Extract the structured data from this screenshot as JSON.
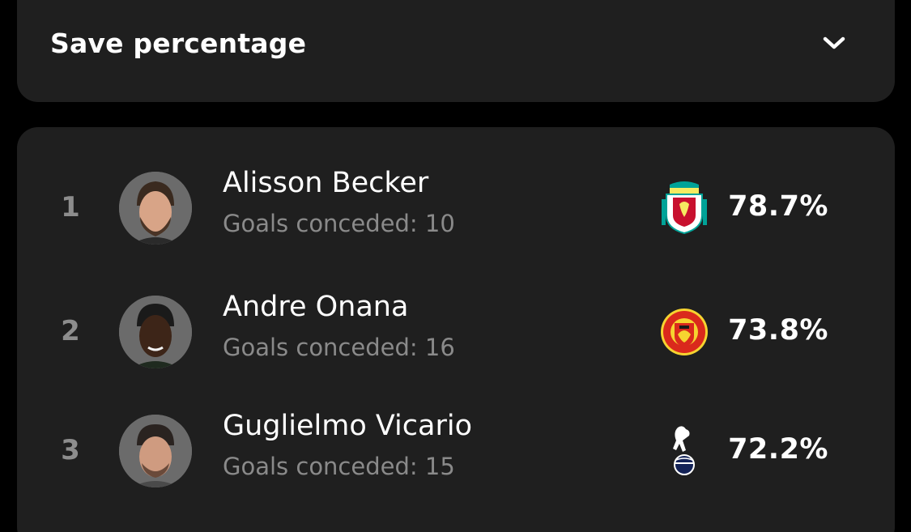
{
  "dropdown": {
    "label": "Save percentage",
    "icon": "chevron-down-icon"
  },
  "players": [
    {
      "rank": "1",
      "name": "Alisson Becker",
      "goals_conceded": "Goals conceded: 10",
      "club_crest": "liverpool-crest-icon",
      "save_pct": "78.7%"
    },
    {
      "rank": "2",
      "name": "Andre Onana",
      "goals_conceded": "Goals conceded: 16",
      "club_crest": "manchester-united-crest-icon",
      "save_pct": "73.8%"
    },
    {
      "rank": "3",
      "name": "Guglielmo Vicario",
      "goals_conceded": "Goals conceded: 15",
      "club_crest": "tottenham-crest-icon",
      "save_pct": "72.2%"
    }
  ],
  "colors": {
    "background": "#000000",
    "card": "#1f1f1f",
    "muted_text": "#8a8a8a",
    "liverpool_red": "#c8102e",
    "united_red": "#da291c",
    "spurs_navy": "#132257"
  }
}
